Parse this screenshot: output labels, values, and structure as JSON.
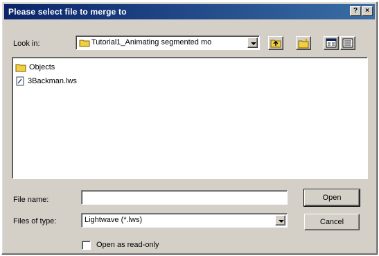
{
  "window": {
    "title": "Please select file to merge to",
    "help_label": "?",
    "close_label": "×"
  },
  "lookin": {
    "label": "Look in:",
    "folder": "Tutorial1_Animating segmented mo"
  },
  "toolbar": {
    "up_icon": "up-folder-icon",
    "new_folder_icon": "new-folder-icon",
    "list_icon": "list-view-icon",
    "details_icon": "details-view-icon"
  },
  "files": [
    {
      "name": "Objects",
      "icon": "folder-icon"
    },
    {
      "name": "3Backman.lws",
      "icon": "file-icon"
    }
  ],
  "filename": {
    "label": "File name:",
    "value": ""
  },
  "filetype": {
    "label": "Files of type:",
    "value": "Lightwave (*.lws)"
  },
  "buttons": {
    "open": "Open",
    "cancel": "Cancel"
  },
  "readonly": {
    "label": "Open as read-only",
    "checked": false
  }
}
